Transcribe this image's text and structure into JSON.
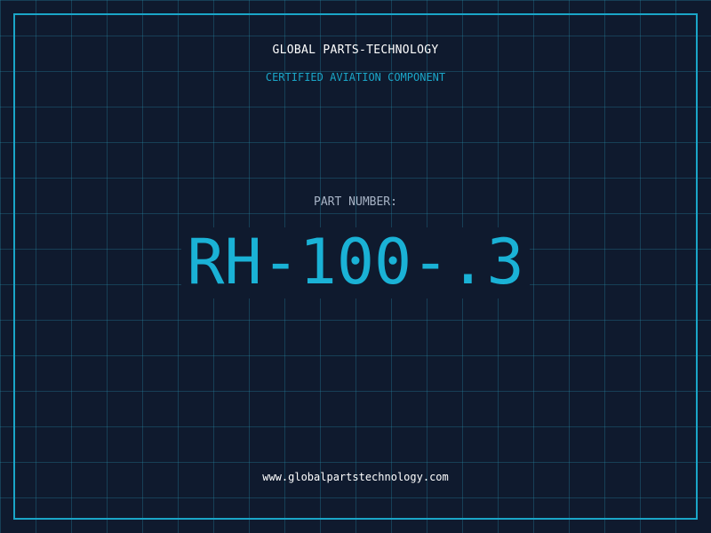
{
  "header": {
    "company": "GLOBAL PARTS-TECHNOLOGY",
    "tagline": "CERTIFIED AVIATION COMPONENT"
  },
  "part": {
    "label": "PART NUMBER:",
    "number": "RH-100-.3"
  },
  "footer": {
    "website": "www.globalpartstechnology.com"
  },
  "colors": {
    "background": "#0f1a2e",
    "grid": "#288caa",
    "accent": "#1aa6c8",
    "text": "#ffffff",
    "muted": "#a8b4c6"
  }
}
